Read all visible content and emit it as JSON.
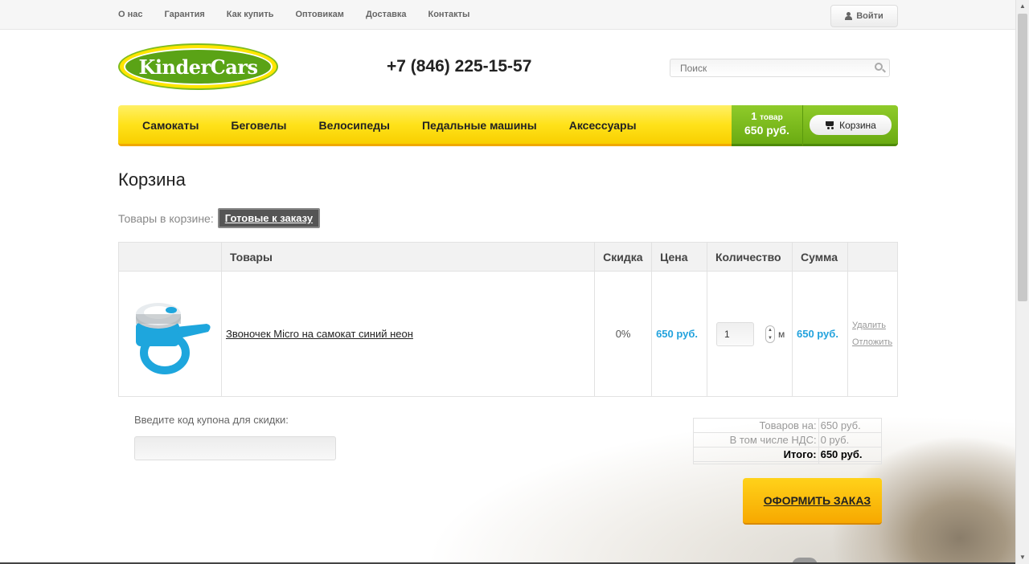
{
  "topnav": {
    "items": [
      "О нас",
      "Гарантия",
      "Как купить",
      "Оптовикам",
      "Доставка",
      "Контакты"
    ],
    "login_label": "Войти"
  },
  "header": {
    "logo_text": "KinderCars",
    "phone": "+7 (846) 225-15-57",
    "search_placeholder": "Поиск"
  },
  "mainnav": {
    "items": [
      "Самокаты",
      "Беговелы",
      "Велосипеды",
      "Педальные машины",
      "Аксессуары"
    ]
  },
  "cart_summary": {
    "count": "1",
    "count_label": "товар",
    "sum": "650 руб.",
    "cart_button_label": "Корзина"
  },
  "page": {
    "title": "Корзина",
    "tabs_label": "Товары в корзине:",
    "active_tab": "Готовые к заказу"
  },
  "table": {
    "headers": [
      "",
      "Товары",
      "Скидка",
      "Цена",
      "Количество",
      "Сумма",
      ""
    ],
    "rows": [
      {
        "name": "Звоночек Micro на самокат синий неон",
        "discount": "0%",
        "price": "650 руб.",
        "quantity": "1",
        "unit": "м",
        "sum": "650 руб.",
        "delete_label": "Удалить",
        "postpone_label": "Отложить"
      }
    ]
  },
  "coupon": {
    "label": "Введите код купона для скидки:",
    "value": ""
  },
  "totals": {
    "items_label": "Товаров на:",
    "items_value": "650 руб.",
    "vat_label": "В том числе НДС:",
    "vat_value": "0 руб.",
    "total_label": "Итого:",
    "total_value": "650 руб."
  },
  "order_button_label": "ОФОРМИТЬ ЗАКАЗ",
  "colors": {
    "accent_yellow": "#ffe21a",
    "accent_green": "#7dbc1e",
    "price_blue": "#22a2dd",
    "order_orange": "#f7a800"
  }
}
